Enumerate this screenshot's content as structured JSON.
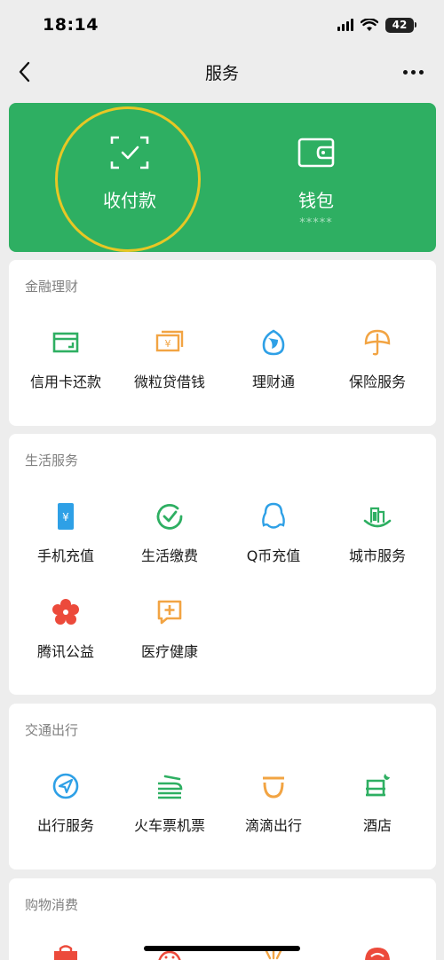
{
  "status_bar": {
    "time": "18:14",
    "battery": "42"
  },
  "nav": {
    "title": "服务"
  },
  "top_card": {
    "pay": {
      "label": "收付款"
    },
    "wallet": {
      "label": "钱包",
      "sub": "*****"
    }
  },
  "sections": [
    {
      "title": "金融理财",
      "items": [
        {
          "label": "信用卡还款",
          "icon": "credit-card-icon"
        },
        {
          "label": "微粒贷借钱",
          "icon": "money-stack-icon"
        },
        {
          "label": "理财通",
          "icon": "wealth-drop-icon"
        },
        {
          "label": "保险服务",
          "icon": "umbrella-icon"
        }
      ]
    },
    {
      "title": "生活服务",
      "items": [
        {
          "label": "手机充值",
          "icon": "mobile-phone-icon"
        },
        {
          "label": "生活缴费",
          "icon": "check-circle-icon"
        },
        {
          "label": "Q币充值",
          "icon": "penguin-icon"
        },
        {
          "label": "城市服务",
          "icon": "city-buildings-icon"
        },
        {
          "label": "腾讯公益",
          "icon": "flower-icon"
        },
        {
          "label": "医疗健康",
          "icon": "medical-plus-icon"
        }
      ]
    },
    {
      "title": "交通出行",
      "items": [
        {
          "label": "出行服务",
          "icon": "navigation-arrow-icon"
        },
        {
          "label": "火车票机票",
          "icon": "train-plane-icon"
        },
        {
          "label": "滴滴出行",
          "icon": "didi-icon"
        },
        {
          "label": "酒店",
          "icon": "hotel-bed-icon"
        }
      ]
    },
    {
      "title": "购物消费",
      "items": []
    }
  ],
  "colors": {
    "wallet_green": "#2eaf62",
    "finance_green": "#2eaf62",
    "orange": "#f2a443",
    "blue": "#2ea0e6",
    "red": "#ec4a3b",
    "highlight_ring": "#e8c724"
  }
}
